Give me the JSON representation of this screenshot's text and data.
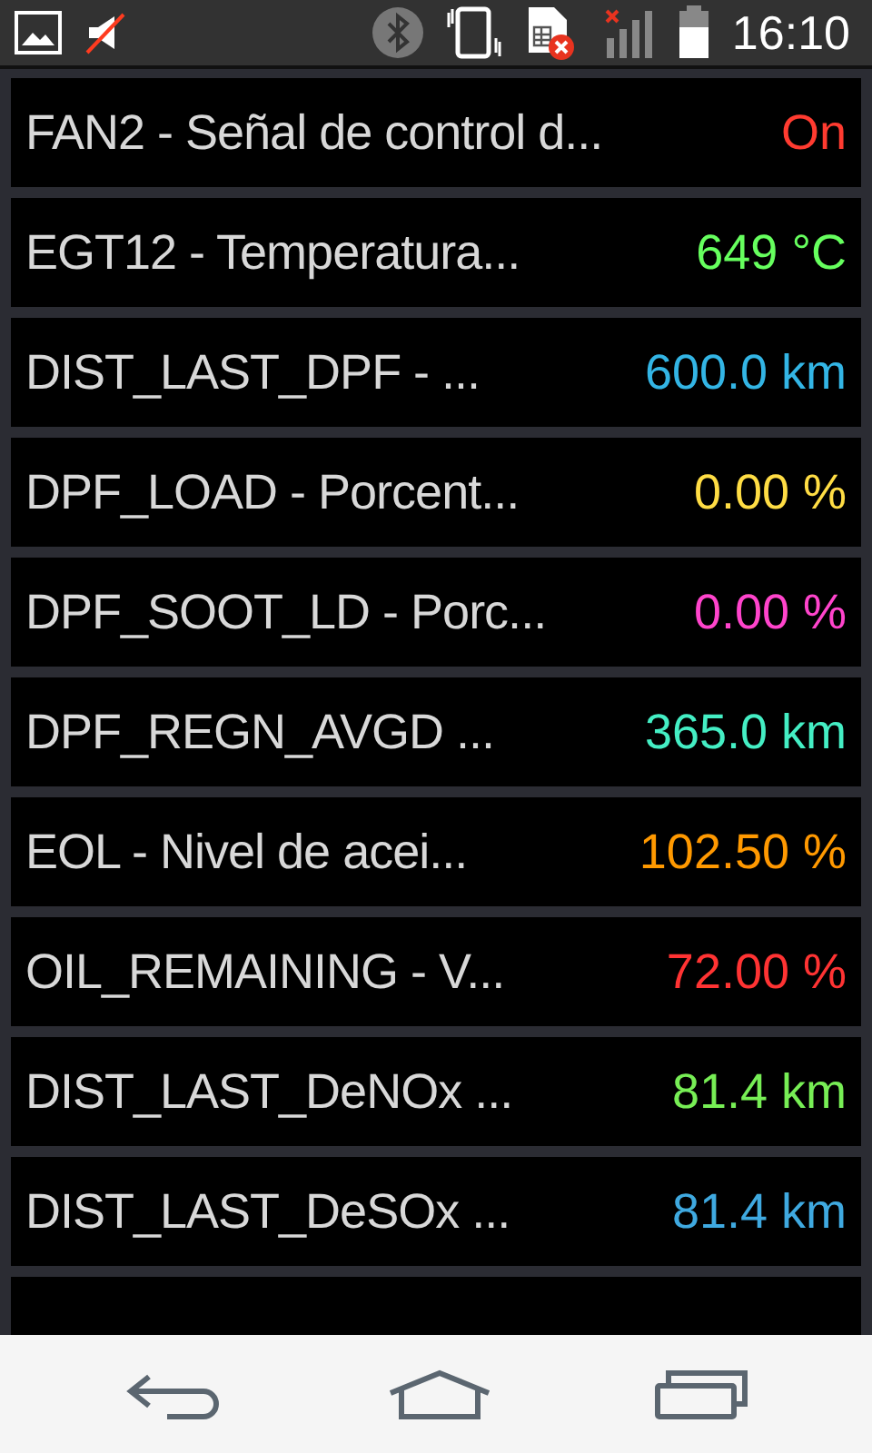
{
  "status_bar": {
    "time": "16:10"
  },
  "rows": [
    {
      "label": "FAN2 - Señal de control d...",
      "value": "On",
      "color": "#ff3b30"
    },
    {
      "label": "EGT12 - Temperatura...",
      "value": "649 °C",
      "color": "#66ff5e"
    },
    {
      "label": "DIST_LAST_DPF - ...",
      "value": "600.0 km",
      "color": "#33b5e5"
    },
    {
      "label": "DPF_LOAD - Porcent...",
      "value": "0.00 %",
      "color": "#ffdd44"
    },
    {
      "label": "DPF_SOOT_LD - Porc...",
      "value": "0.00 %",
      "color": "#ff44cc"
    },
    {
      "label": "DPF_REGN_AVGD ...",
      "value": "365.0 km",
      "color": "#44eec4"
    },
    {
      "label": "EOL - Nivel de acei...",
      "value": "102.50 %",
      "color": "#ff9900"
    },
    {
      "label": "OIL_REMAINING - V...",
      "value": "72.00 %",
      "color": "#ff3333"
    },
    {
      "label": "DIST_LAST_DeNOx ...",
      "value": "81.4 km",
      "color": "#77ee55"
    },
    {
      "label": "DIST_LAST_DeSOx ...",
      "value": "81.4 km",
      "color": "#3fa9e0"
    }
  ]
}
